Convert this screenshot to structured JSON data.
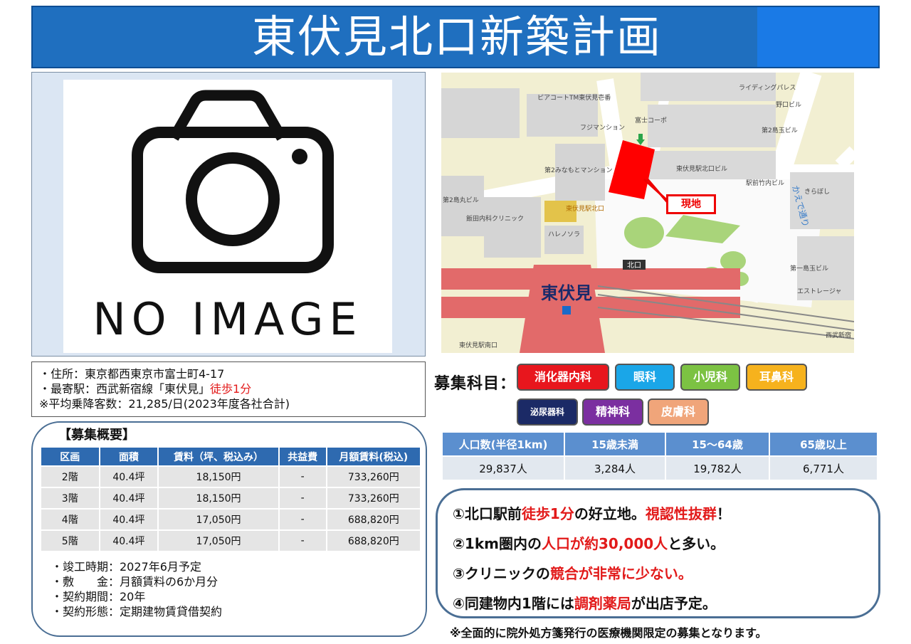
{
  "title": "東伏見北口新築計画",
  "photo": {
    "placeholder_text": "NO IMAGE"
  },
  "map": {
    "site_label": "現地",
    "station_name": "東伏見",
    "exit_label": "北口",
    "labels": [
      "ピアコートTM東伏見壱番",
      "富士コーポ",
      "ライディングパレス",
      "野口ビル",
      "第2島玉ビル",
      "フジマンション",
      "東伏見駅北口ビル",
      "第2みなもとマンション",
      "駅前竹内ビル",
      "きらぼし",
      "第2島丸ビル",
      "飯田内科クリニック",
      "東伏見駅北口",
      "ハレノソラ",
      "第一島玉ビル",
      "エストレージャ",
      "かえで通り",
      "西武新宿",
      "東伏見駅南口"
    ]
  },
  "address": {
    "line1": "・住所：東京都西東京市富士町4-17",
    "line2_prefix": "・最寄駅：西武新宿線「東伏見」",
    "line2_red": "徒歩1分",
    "line3": "※平均乗降客数：21,285/日(2023年度各社合計)"
  },
  "recruit": {
    "title": "【募集概要】",
    "headers": [
      "区画",
      "面積",
      "賃料（坪、税込み）",
      "共益費",
      "月額賃料(税込)"
    ],
    "rows": [
      [
        "2階",
        "40.4坪",
        "18,150円",
        "-",
        "733,260円"
      ],
      [
        "3階",
        "40.4坪",
        "18,150円",
        "-",
        "733,260円"
      ],
      [
        "4階",
        "40.4坪",
        "17,050円",
        "-",
        "688,820円"
      ],
      [
        "5階",
        "40.4坪",
        "17,050円",
        "-",
        "688,820円"
      ]
    ],
    "notes": [
      "・竣工時期：2027年6月予定",
      "・敷　　金：月額賃料の6か月分",
      "・契約期間：20年",
      "・契約形態：定期建物賃貸借契約"
    ]
  },
  "departments": {
    "label": "募集科目：",
    "items": [
      {
        "name": "消化器内科",
        "color": "#e8161d"
      },
      {
        "name": "眼科",
        "color": "#1aa6e8"
      },
      {
        "name": "小児科",
        "color": "#7cc243"
      },
      {
        "name": "耳鼻科",
        "color": "#f6b21d"
      },
      {
        "name": "泌尿器科",
        "color": "#1b2a66"
      },
      {
        "name": "精神科",
        "color": "#7b2fa0"
      },
      {
        "name": "皮膚科",
        "color": "#f0a57a"
      }
    ]
  },
  "population": {
    "headers": [
      "人口数(半径1km)",
      "15歳未満",
      "15～64歳",
      "65歳以上"
    ],
    "values": [
      "29,837人",
      "3,284人",
      "19,782人",
      "6,771人"
    ]
  },
  "points": [
    {
      "prefix": "①北口駅前",
      "red": "徒歩1分",
      "middle": "の好立地。",
      "red2": "視認性抜群",
      "suffix": "！"
    },
    {
      "prefix": "②1km圏内の",
      "red": "人口が約30,000人",
      "middle": "と多い。",
      "red2": "",
      "suffix": ""
    },
    {
      "prefix": "③クリニックの",
      "red": "競合が非常に少ない。",
      "middle": "",
      "red2": "",
      "suffix": ""
    },
    {
      "prefix": "④同建物内1階には",
      "red": "調剤薬局",
      "middle": "が出店予定。",
      "red2": "",
      "suffix": ""
    }
  ],
  "footnote": "※全面的に院外処方箋発行の医療機関限定の募集となります。"
}
